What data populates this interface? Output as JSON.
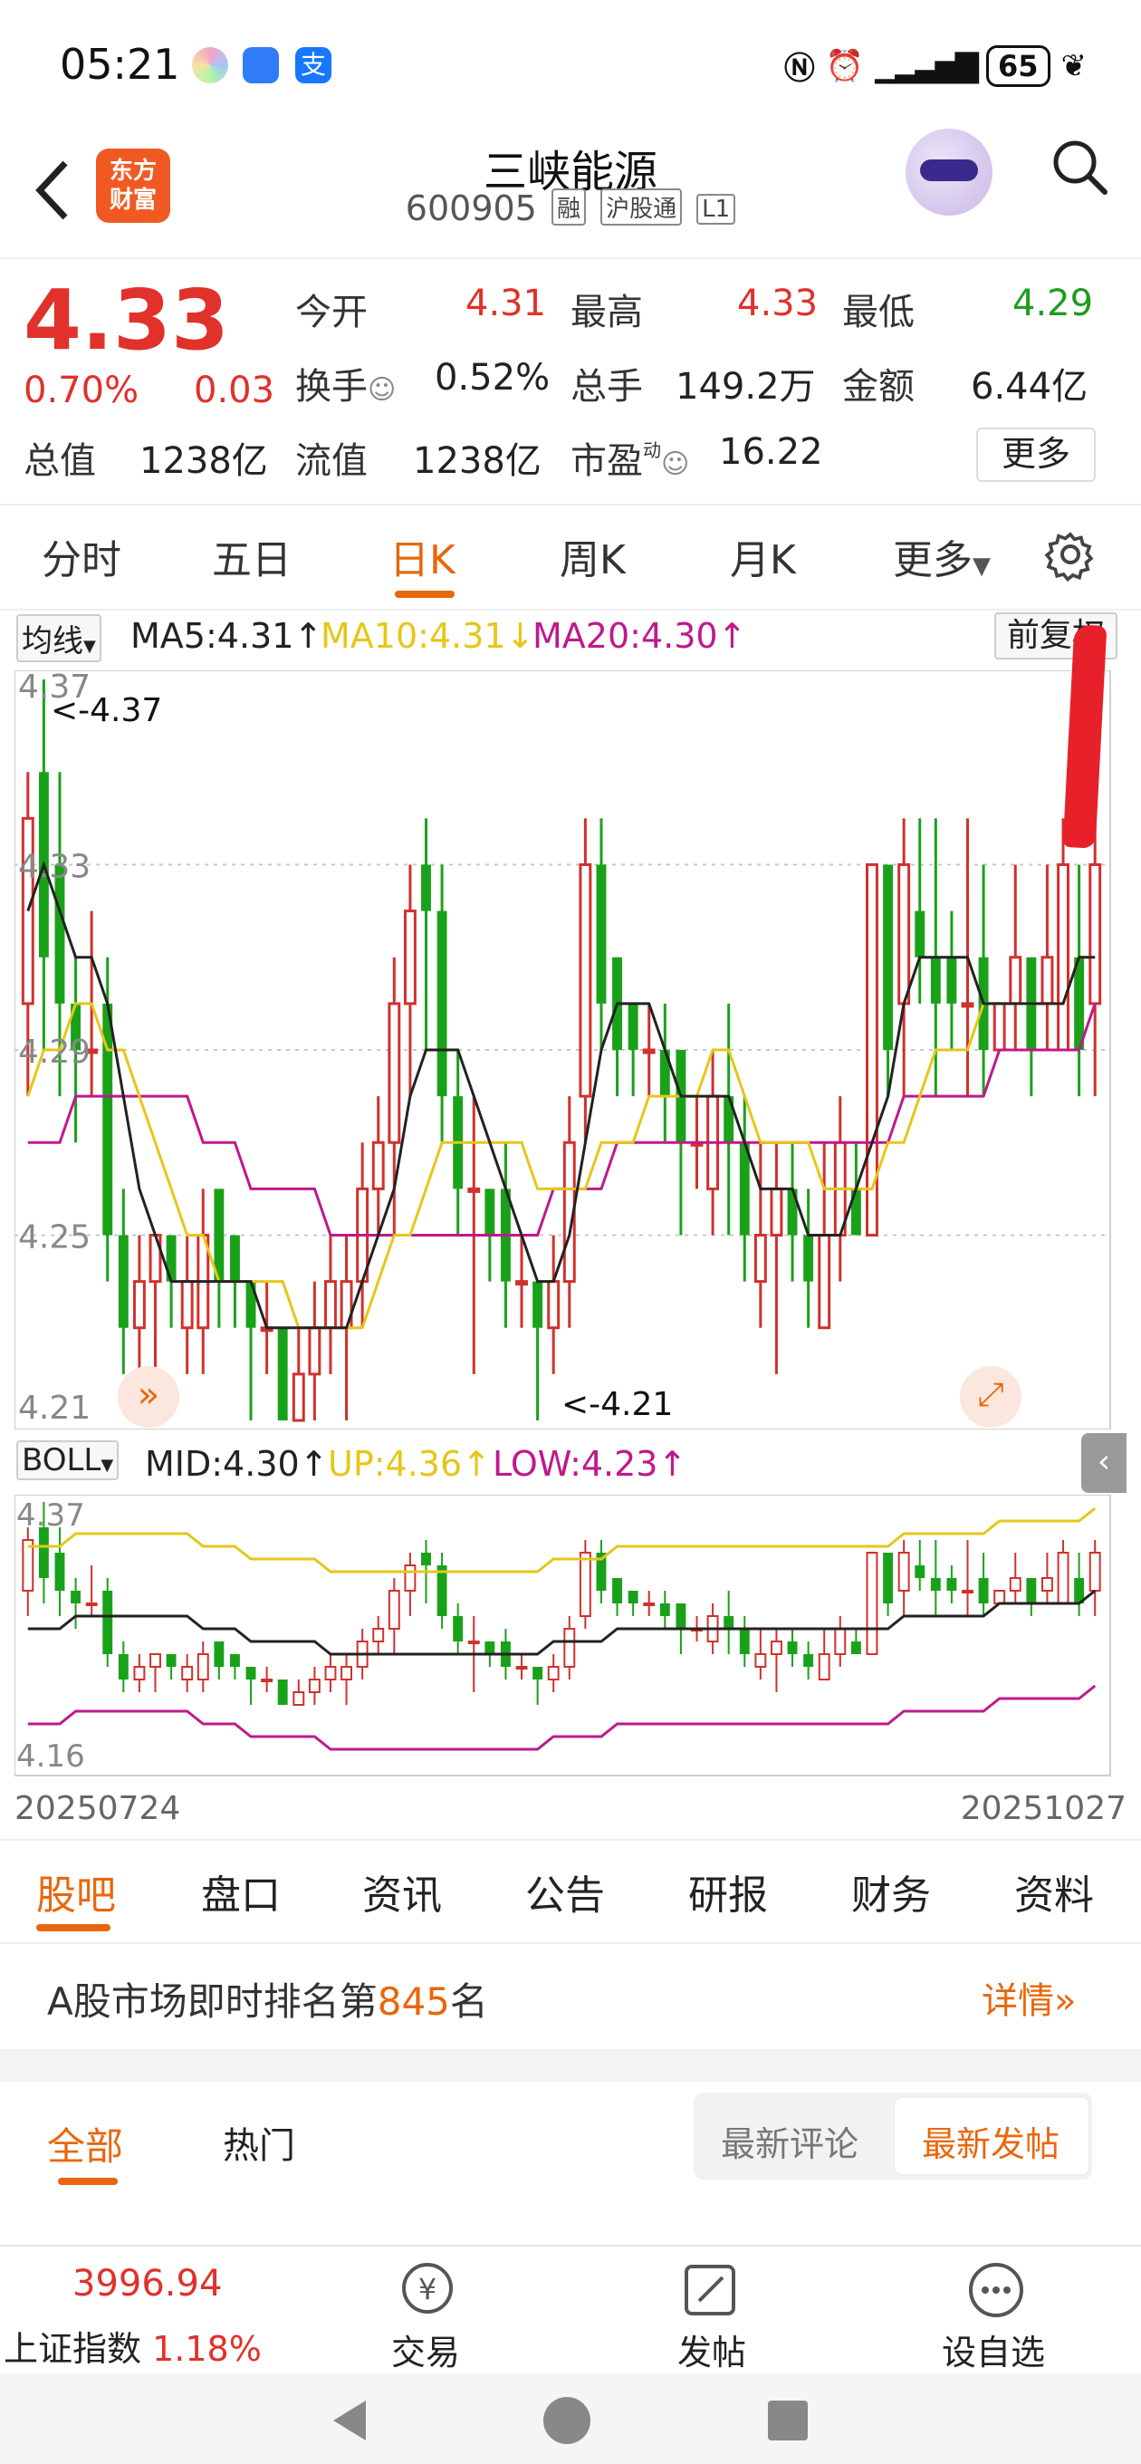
{
  "status_bar": {
    "time": "05:21",
    "battery": "65",
    "app_icons": [
      "gallery-icon",
      "message-icon",
      "alipay-icon"
    ],
    "alipay_glyph": "支"
  },
  "header": {
    "logo_text_1": "东方",
    "logo_text_2": "财富",
    "stock_name": "三峡能源",
    "stock_code": "600905",
    "tags": [
      "融",
      "沪股通",
      "L1"
    ]
  },
  "quote": {
    "price": "4.33",
    "change_pct": "0.70%",
    "change_amt": "0.03",
    "rows": [
      [
        {
          "label": "今开",
          "value": "4.31",
          "color": "red"
        },
        {
          "label": "最高",
          "value": "4.33",
          "color": "red"
        },
        {
          "label": "最低",
          "value": "4.29",
          "color": "green"
        }
      ],
      [
        {
          "label": "换手",
          "value": "0.52%",
          "color": "black"
        },
        {
          "label": "总手",
          "value": "149.2万",
          "color": "black"
        },
        {
          "label": "金额",
          "value": "6.44亿",
          "color": "black"
        }
      ],
      [
        {
          "label": "总值",
          "value": "1238亿",
          "color": "black"
        },
        {
          "label": "流值",
          "value": "1238亿",
          "color": "black"
        },
        {
          "label": "市盈",
          "value": "16.22",
          "color": "black"
        }
      ]
    ],
    "pe_superscript": "动",
    "more_button": "更多"
  },
  "period_tabs": [
    "分时",
    "五日",
    "日K",
    "周K",
    "月K",
    "更多"
  ],
  "active_period": "日K",
  "main_chart": {
    "indicator_select": "均线",
    "legend": [
      {
        "text": "MA5:4.31↑",
        "color": "#222222"
      },
      {
        "text": "MA10:4.31↓",
        "color": "#e6c619"
      },
      {
        "text": "MA20:4.30↑",
        "color": "#c0188c"
      }
    ],
    "adjust_button": "前复权",
    "y_ticks": [
      "4.37",
      "4.33",
      "4.29",
      "4.25",
      "4.21"
    ],
    "max_label": "<-4.37",
    "min_label": "<-4.21"
  },
  "sub_chart": {
    "indicator_select": "BOLL",
    "legend": [
      {
        "text": "MID:4.30↑",
        "color": "#222222"
      },
      {
        "text": "UP:4.36↑",
        "color": "#e6c619"
      },
      {
        "text": "LOW:4.23↑",
        "color": "#c0188c"
      }
    ],
    "y_ticks": [
      "4.37",
      "4.16"
    ]
  },
  "chart_data": {
    "type": "candlestick",
    "title": "",
    "xlabel": "",
    "ylabel": "",
    "x_range": [
      "20250724",
      "20251027"
    ],
    "ylim": [
      4.21,
      4.37
    ],
    "colors": {
      "up": "#d0312d",
      "down": "#1aa11a",
      "ma5": "#222222",
      "ma10": "#e6c619",
      "ma20": "#c0188c"
    },
    "candles": [
      [
        4.3,
        4.34,
        4.35,
        4.28
      ],
      [
        4.35,
        4.31,
        4.37,
        4.29
      ],
      [
        4.33,
        4.3,
        4.35,
        4.28
      ],
      [
        4.3,
        4.29,
        4.31,
        4.27
      ],
      [
        4.29,
        4.29,
        4.32,
        4.28
      ],
      [
        4.3,
        4.25,
        4.31,
        4.24
      ],
      [
        4.25,
        4.23,
        4.26,
        4.22
      ],
      [
        4.23,
        4.24,
        4.25,
        4.22
      ],
      [
        4.24,
        4.25,
        4.25,
        4.22
      ],
      [
        4.25,
        4.24,
        4.25,
        4.23
      ],
      [
        4.23,
        4.24,
        4.25,
        4.22
      ],
      [
        4.23,
        4.25,
        4.26,
        4.22
      ],
      [
        4.26,
        4.24,
        4.26,
        4.23
      ],
      [
        4.25,
        4.24,
        4.25,
        4.23
      ],
      [
        4.24,
        4.23,
        4.24,
        4.21
      ],
      [
        4.23,
        4.23,
        4.24,
        4.22
      ],
      [
        4.23,
        4.21,
        4.23,
        4.21
      ],
      [
        4.21,
        4.22,
        4.23,
        4.21
      ],
      [
        4.22,
        4.23,
        4.24,
        4.21
      ],
      [
        4.23,
        4.24,
        4.25,
        4.22
      ],
      [
        4.23,
        4.24,
        4.25,
        4.21
      ],
      [
        4.24,
        4.26,
        4.27,
        4.23
      ],
      [
        4.26,
        4.27,
        4.28,
        4.25
      ],
      [
        4.27,
        4.3,
        4.31,
        4.25
      ],
      [
        4.3,
        4.32,
        4.33,
        4.28
      ],
      [
        4.33,
        4.32,
        4.34,
        4.29
      ],
      [
        4.32,
        4.28,
        4.33,
        4.27
      ],
      [
        4.28,
        4.26,
        4.29,
        4.25
      ],
      [
        4.26,
        4.26,
        4.28,
        4.22
      ],
      [
        4.26,
        4.25,
        4.26,
        4.24
      ],
      [
        4.26,
        4.24,
        4.27,
        4.23
      ],
      [
        4.24,
        4.24,
        4.25,
        4.23
      ],
      [
        4.24,
        4.23,
        4.24,
        4.21
      ],
      [
        4.23,
        4.24,
        4.25,
        4.22
      ],
      [
        4.24,
        4.27,
        4.28,
        4.23
      ],
      [
        4.28,
        4.33,
        4.34,
        4.27
      ],
      [
        4.33,
        4.3,
        4.34,
        4.29
      ],
      [
        4.31,
        4.29,
        4.31,
        4.28
      ],
      [
        4.3,
        4.29,
        4.3,
        4.28
      ],
      [
        4.29,
        4.29,
        4.3,
        4.28
      ],
      [
        4.29,
        4.28,
        4.3,
        4.27
      ],
      [
        4.29,
        4.27,
        4.29,
        4.25
      ],
      [
        4.27,
        4.27,
        4.28,
        4.26
      ],
      [
        4.26,
        4.28,
        4.29,
        4.25
      ],
      [
        4.28,
        4.27,
        4.3,
        4.25
      ],
      [
        4.27,
        4.25,
        4.28,
        4.24
      ],
      [
        4.24,
        4.25,
        4.27,
        4.23
      ],
      [
        4.25,
        4.26,
        4.27,
        4.22
      ],
      [
        4.26,
        4.25,
        4.27,
        4.24
      ],
      [
        4.25,
        4.24,
        4.26,
        4.23
      ],
      [
        4.23,
        4.25,
        4.27,
        4.23
      ],
      [
        4.25,
        4.27,
        4.28,
        4.24
      ],
      [
        4.26,
        4.25,
        4.27,
        4.25
      ],
      [
        4.25,
        4.33,
        4.33,
        4.25
      ],
      [
        4.33,
        4.29,
        4.33,
        4.28
      ],
      [
        4.3,
        4.33,
        4.34,
        4.28
      ],
      [
        4.32,
        4.31,
        4.34,
        4.3
      ],
      [
        4.31,
        4.3,
        4.34,
        4.28
      ],
      [
        4.31,
        4.3,
        4.32,
        4.29
      ],
      [
        4.3,
        4.3,
        4.34,
        4.28
      ],
      [
        4.31,
        4.29,
        4.33,
        4.28
      ],
      [
        4.29,
        4.3,
        4.3,
        4.29
      ],
      [
        4.3,
        4.31,
        4.33,
        4.29
      ],
      [
        4.31,
        4.29,
        4.31,
        4.28
      ],
      [
        4.3,
        4.31,
        4.33,
        4.29
      ],
      [
        4.29,
        4.33,
        4.34,
        4.29
      ],
      [
        4.31,
        4.29,
        4.33,
        4.28
      ],
      [
        4.3,
        4.33,
        4.34,
        4.28
      ]
    ],
    "ma5": [
      4.32,
      4.33,
      4.32,
      4.31,
      4.31,
      4.3,
      4.28,
      4.26,
      4.25,
      4.24,
      4.24,
      4.24,
      4.24,
      4.24,
      4.24,
      4.23,
      4.23,
      4.23,
      4.23,
      4.23,
      4.23,
      4.24,
      4.25,
      4.26,
      4.28,
      4.29,
      4.29,
      4.29,
      4.28,
      4.27,
      4.26,
      4.25,
      4.24,
      4.24,
      4.25,
      4.27,
      4.29,
      4.3,
      4.3,
      4.3,
      4.29,
      4.28,
      4.28,
      4.28,
      4.28,
      4.27,
      4.26,
      4.26,
      4.26,
      4.25,
      4.25,
      4.25,
      4.26,
      4.27,
      4.28,
      4.3,
      4.31,
      4.31,
      4.31,
      4.31,
      4.3,
      4.3,
      4.3,
      4.3,
      4.3,
      4.3,
      4.31,
      4.31
    ],
    "ma10": [
      4.28,
      4.29,
      4.29,
      4.3,
      4.3,
      4.29,
      4.29,
      4.28,
      4.27,
      4.26,
      4.25,
      4.25,
      4.24,
      4.24,
      4.24,
      4.24,
      4.24,
      4.23,
      4.23,
      4.23,
      4.23,
      4.23,
      4.24,
      4.25,
      4.25,
      4.26,
      4.27,
      4.27,
      4.27,
      4.27,
      4.27,
      4.27,
      4.26,
      4.26,
      4.26,
      4.26,
      4.27,
      4.27,
      4.27,
      4.28,
      4.28,
      4.28,
      4.28,
      4.29,
      4.29,
      4.28,
      4.27,
      4.27,
      4.27,
      4.27,
      4.26,
      4.26,
      4.26,
      4.26,
      4.27,
      4.27,
      4.28,
      4.29,
      4.29,
      4.29,
      4.3,
      4.3,
      4.3,
      4.3,
      4.3,
      4.3,
      4.31,
      4.31
    ],
    "ma20": [
      4.27,
      4.27,
      4.27,
      4.28,
      4.28,
      4.28,
      4.28,
      4.28,
      4.28,
      4.28,
      4.28,
      4.27,
      4.27,
      4.27,
      4.26,
      4.26,
      4.26,
      4.26,
      4.26,
      4.25,
      4.25,
      4.25,
      4.25,
      4.25,
      4.25,
      4.25,
      4.25,
      4.25,
      4.25,
      4.25,
      4.25,
      4.25,
      4.25,
      4.26,
      4.26,
      4.26,
      4.26,
      4.27,
      4.27,
      4.27,
      4.27,
      4.27,
      4.27,
      4.27,
      4.27,
      4.27,
      4.27,
      4.27,
      4.27,
      4.27,
      4.27,
      4.27,
      4.27,
      4.27,
      4.27,
      4.28,
      4.28,
      4.28,
      4.28,
      4.28,
      4.28,
      4.29,
      4.29,
      4.29,
      4.29,
      4.29,
      4.29,
      4.3
    ]
  },
  "content_tabs": [
    "股吧",
    "盘口",
    "资讯",
    "公告",
    "研报",
    "财务",
    "资料"
  ],
  "rank": {
    "prefix": "A股市场即时排名第",
    "number": "845",
    "suffix": "名",
    "detail": "详情"
  },
  "feed_tabs": {
    "all": "全部",
    "hot": "热门",
    "latest_comment": "最新评论",
    "latest_post": "最新发帖"
  },
  "bottom_bar": {
    "index_value": "3996.94",
    "index_name": "上证指数",
    "index_change": "1.18%",
    "trade": "交易",
    "post": "发帖",
    "watchlist": "设自选"
  }
}
